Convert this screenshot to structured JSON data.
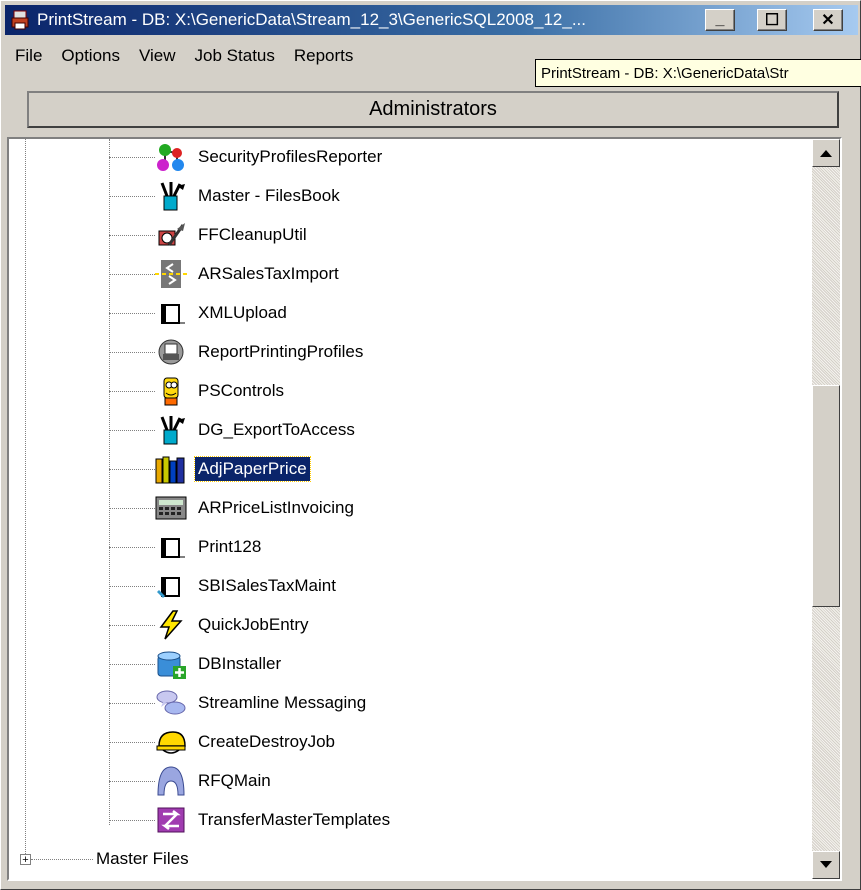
{
  "window": {
    "title": "PrintStream - DB: X:\\GenericData\\Stream_12_3\\GenericSQL2008_12_...",
    "controls": {
      "minimize": "_",
      "maximize": "☐",
      "close": "✕"
    }
  },
  "menu": [
    "File",
    "Options",
    "View",
    "Job Status",
    "Reports"
  ],
  "tooltip": "PrintStream - DB: X:\\GenericData\\Str",
  "header": {
    "title": "Administrators"
  },
  "tree": {
    "items": [
      {
        "label": "SecurityProfilesReporter",
        "icon": "molecule-icon"
      },
      {
        "label": "Master - FilesBook",
        "icon": "paintbrush-cup-icon"
      },
      {
        "label": "FFCleanupUtil",
        "icon": "cleanup-icon"
      },
      {
        "label": "ARSalesTaxImport",
        "icon": "import-arrows-icon"
      },
      {
        "label": "XMLUpload",
        "icon": "window-icon"
      },
      {
        "label": "ReportPrintingProfiles",
        "icon": "printer-icon"
      },
      {
        "label": "PSControls",
        "icon": "cartoon-face-icon"
      },
      {
        "label": "DG_ExportToAccess",
        "icon": "paintbrush-cup-icon"
      },
      {
        "label": "AdjPaperPrice",
        "icon": "books-icon",
        "selected": true
      },
      {
        "label": "ARPriceListInvoicing",
        "icon": "calculator-icon"
      },
      {
        "label": "Print128",
        "icon": "window-icon"
      },
      {
        "label": "SBISalesTaxMaint",
        "icon": "window-cursor-icon"
      },
      {
        "label": "QuickJobEntry",
        "icon": "lightning-icon"
      },
      {
        "label": "DBInstaller",
        "icon": "database-add-icon"
      },
      {
        "label": "Streamline Messaging",
        "icon": "chat-bubbles-icon"
      },
      {
        "label": "CreateDestroyJob",
        "icon": "hardhat-icon"
      },
      {
        "label": "RFQMain",
        "icon": "arch-icon"
      },
      {
        "label": "TransferMasterTemplates",
        "icon": "transfer-icon"
      }
    ],
    "collapsed_node": {
      "label": "Master Files",
      "expander": "+"
    }
  },
  "colors": {
    "selection": "#0a246a",
    "title_start": "#0a246a",
    "title_end": "#a6caf0"
  }
}
